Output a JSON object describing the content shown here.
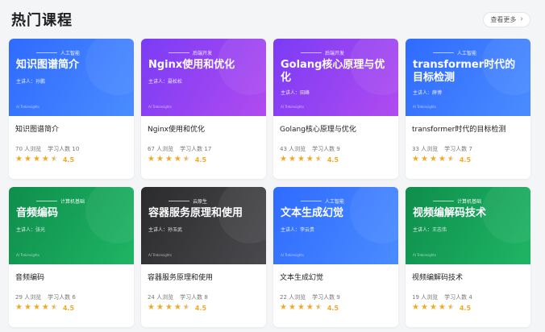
{
  "header": {
    "title": "热门课程",
    "see_more": "查看更多",
    "chevron": "›"
  },
  "courses": [
    {
      "category": "人工智能",
      "banner_title": "知识图谱简介",
      "lecturer": "主讲人：孙鹏",
      "brand": "AI Trekinsights",
      "title": "知识图谱简介",
      "views": "70 人浏览",
      "learners": "学习人数 10",
      "rating": "4.5",
      "gradient": [
        "#2f6bff",
        "#4a8cff"
      ]
    },
    {
      "category": "后端开发",
      "banner_title": "Nginx使用和优化",
      "lecturer": "主讲人：聂松松",
      "brand": "AI Trekinsights",
      "title": "Nginx使用和优化",
      "views": "67 人浏览",
      "learners": "学习人数 17",
      "rating": "4.5",
      "gradient": [
        "#7b3cf5",
        "#b04bf0"
      ]
    },
    {
      "category": "后端开发",
      "banner_title": "Golang核心原理与优化",
      "lecturer": "主讲人：田峰",
      "brand": "AI Trekinsights",
      "title": "Golang核心原理与优化",
      "views": "43 人浏览",
      "learners": "学习人数 9",
      "rating": "4.5",
      "gradient": [
        "#7b3cf5",
        "#b04bf0"
      ]
    },
    {
      "category": "人工智能",
      "banner_title": "transformer时代的目标检测",
      "lecturer": "主讲人：薛博",
      "brand": "AI Trekinsights",
      "title": "transformer时代的目标检测",
      "views": "33 人浏览",
      "learners": "学习人数 7",
      "rating": "4.5",
      "gradient": [
        "#2f6bff",
        "#4a8cff"
      ]
    },
    {
      "category": "计算机基础",
      "banner_title": "音频编码",
      "lecturer": "主讲人：张光",
      "brand": "AI Trekinsights",
      "title": "音频编码",
      "views": "29 人浏览",
      "learners": "学习人数 6",
      "rating": "4.5",
      "gradient": [
        "#0e8e4b",
        "#1fb565"
      ]
    },
    {
      "category": "云原生",
      "banner_title": "容器服务原理和使用",
      "lecturer": "主讲人：孙玉武",
      "brand": "AI Trekinsights",
      "title": "容器服务原理和使用",
      "views": "24 人浏览",
      "learners": "学习人数 8",
      "rating": "4.5",
      "gradient": [
        "#2b2b2d",
        "#4a4a4e"
      ]
    },
    {
      "category": "人工智能",
      "banner_title": "文本生成幻觉",
      "lecturer": "主讲人：李云贵",
      "brand": "AI Trekinsights",
      "title": "文本生成幻觉",
      "views": "22 人浏览",
      "learners": "学习人数 9",
      "rating": "4.5",
      "gradient": [
        "#2f6bff",
        "#4a8cff"
      ]
    },
    {
      "category": "计算机基础",
      "banner_title": "视频编解码技术",
      "lecturer": "主讲人：王志伟",
      "brand": "AI Trekinsights",
      "title": "视频编解码技术",
      "views": "19 人浏览",
      "learners": "学习人数 4",
      "rating": "4.5",
      "gradient": [
        "#0e8e4b",
        "#1fb565"
      ]
    }
  ]
}
